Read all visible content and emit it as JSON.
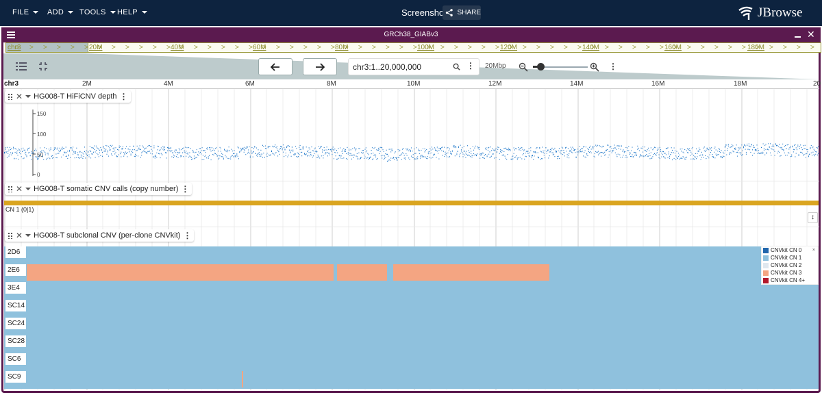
{
  "appbar": {
    "menus": [
      {
        "label": "FILE"
      },
      {
        "label": "ADD"
      },
      {
        "label": "TOOLS"
      },
      {
        "label": "HELP"
      }
    ],
    "session_name": "Screenshot",
    "share_label": "SHARE",
    "logo_text": "JBrowse"
  },
  "view": {
    "assembly_title": "GRCh38_GIABv3",
    "overview": {
      "selected_label": "chr3",
      "ticks": [
        "20M",
        "40M",
        "60M",
        "80M",
        "100M",
        "120M",
        "140M",
        "160M",
        "180M"
      ]
    },
    "nav": {
      "location": "chr3:1..20,000,000",
      "bp_per_view": "20Mbp",
      "zoom_level": 0.15
    },
    "scale": {
      "chr": "chr3",
      "ticks": [
        "2M",
        "4M",
        "6M",
        "8M",
        "10M",
        "12M",
        "14M",
        "16M",
        "18M",
        "20"
      ]
    }
  },
  "tracks": {
    "depth": {
      "name": "HG008-T HiFiCNV depth",
      "axis": [
        "150",
        "100",
        "50",
        "0"
      ],
      "color": "#1f77c9"
    },
    "cnv_calls": {
      "name": "HG008-T somatic CNV calls (copy number)",
      "feature_label": "CN 1 (0|1)",
      "color": "#daa520"
    },
    "subclonal": {
      "name": "HG008-T subclonal CNV (per-clone CNVkit)",
      "rows": [
        "2D6",
        "2E6",
        "3E4",
        "SC14",
        "SC24",
        "SC28",
        "SC6",
        "SC9"
      ],
      "legend": [
        {
          "label": "CNVkit CN 0",
          "color": "#2166ac"
        },
        {
          "label": "CNVkit CN 1",
          "color": "#8fc1dd"
        },
        {
          "label": "CNVkit CN 2",
          "color": "#dfe8ef"
        },
        {
          "label": "CNVkit CN 3",
          "color": "#f4a582"
        },
        {
          "label": "CNVkit CN 4+",
          "color": "#b2182b"
        }
      ]
    }
  }
}
